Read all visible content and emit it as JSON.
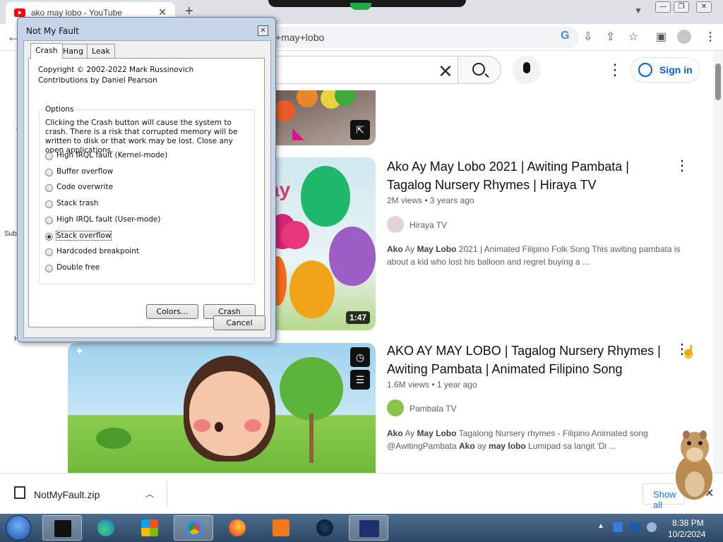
{
  "browser": {
    "tab_title": "ako may lobo - YouTube",
    "tab_close": "✕",
    "new_tab": "+",
    "url_fragment": "+may+lobo",
    "window_buttons": [
      "—",
      "❐",
      "✕"
    ]
  },
  "youtube": {
    "signin_label": "Sign in",
    "videos": [
      {
        "title": "Ako Ay May Lobo 2021 | Awiting Pambata | Tagalog Nursery Rhymes | Hiraya TV",
        "meta": "2M views • 3 years ago",
        "channel": "Hiraya TV",
        "desc_parts": [
          "Ako",
          " Ay ",
          "May Lobo",
          " 2021 | Animated Filipino Folk Song This awiting pambata is about a kid who lost his balloon and regret buying a ..."
        ],
        "duration": "1:47"
      },
      {
        "title": "AKO AY MAY LOBO | Tagalog Nursery Rhymes | Awiting Pambata | Animated Filipino Song",
        "meta": "1.6M views • 1 year ago",
        "channel": "Pambata TV",
        "desc_parts": [
          "Ako",
          " Ay ",
          "May Lobo",
          " Tagalong Nursery rhymes - Filipino Animated song @AwitingPambata ",
          "Ako",
          " ay ",
          "may lobo",
          " Lumipad sa langit 'Di ..."
        ]
      }
    ],
    "side_peek": [
      "Subs",
      "H"
    ]
  },
  "download": {
    "filename": "NotMyFault.zip",
    "show_all": "Show all"
  },
  "dialog": {
    "title": "Not My Fault",
    "tabs": [
      "Crash",
      "Hang",
      "Leak"
    ],
    "copyright_line1": "Copyright © 2002-2022 Mark Russinovich",
    "copyright_line2": "Contributions by Daniel Pearson",
    "options_label": "Options",
    "options_note": "Clicking the Crash button will cause the system to crash. There is a risk that corrupted memory will be written to disk or that work may be lost. Close any open applications.",
    "options": [
      "High IRQL fault (Kernel-mode)",
      "Buffer overflow",
      "Code overwrite",
      "Stack trash",
      "High IRQL fault (User-mode)",
      "Stack overflow",
      "Hardcoded breakpoint",
      "Double free"
    ],
    "selected_option": "Stack overflow",
    "colors_button": "Colors...",
    "crash_button": "Crash",
    "cancel_button": "Cancel"
  },
  "taskbar": {
    "time": "8:38 PM",
    "date": "10/2/2024"
  },
  "colors": {
    "youtube_red": "#ff0000",
    "link_blue": "#065fd4",
    "dialog_frame": "#c5d4e6",
    "taskbar": "#2c4866"
  }
}
